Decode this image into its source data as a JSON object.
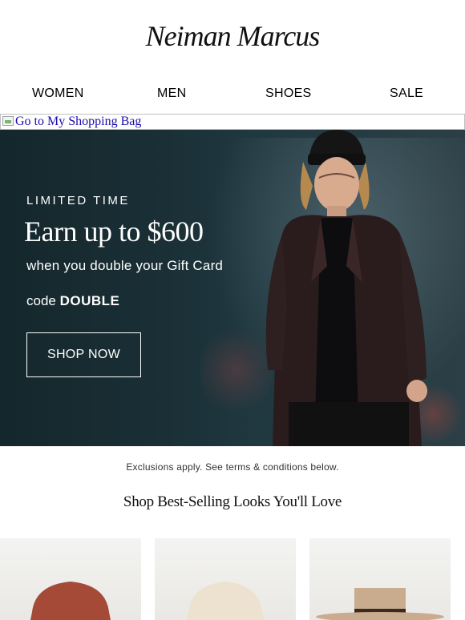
{
  "brand": {
    "logo_text": "Neiman Marcus"
  },
  "nav": {
    "items": [
      "WOMEN",
      "MEN",
      "SHOES",
      "SALE"
    ]
  },
  "bag_link": {
    "alt_text": "Go to My Shopping Bag"
  },
  "hero": {
    "kicker": "LIMITED TIME",
    "headline": "Earn up to $600",
    "subline": "when you double your Gift Card",
    "code_prefix": "code",
    "code_value": "DOUBLE",
    "cta_label": "SHOP NOW"
  },
  "disclaimer": "Exclusions apply. See terms & conditions below.",
  "section_title": "Shop Best-Selling Looks You'll Love",
  "products": [
    {
      "name": "hat-rust",
      "color": "#a44a36"
    },
    {
      "name": "hat-cream",
      "color": "#ece2cf"
    },
    {
      "name": "hat-tan",
      "color": "#c9ab8e"
    }
  ]
}
